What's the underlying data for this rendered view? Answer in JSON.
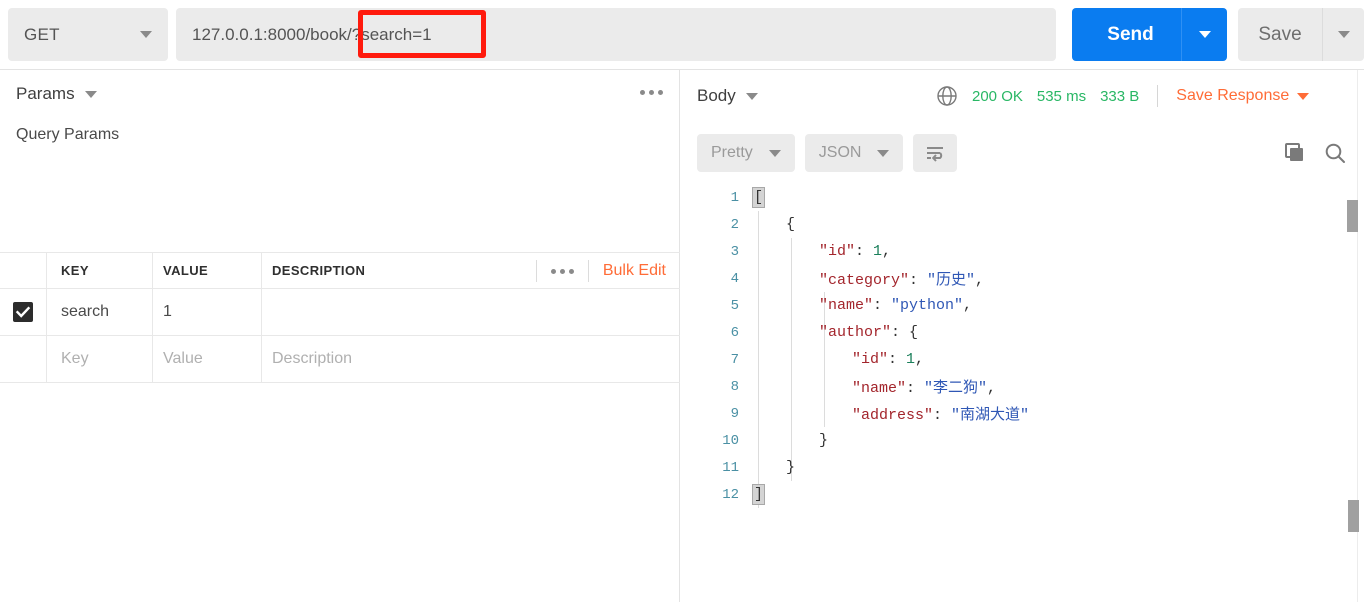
{
  "request_bar": {
    "method": "GET",
    "url": "127.0.0.1:8000/book/?search=1",
    "send_label": "Send",
    "save_label": "Save",
    "annotation_color": "#ff1a0d",
    "send_color": "#0a7cf0"
  },
  "params_panel": {
    "tab_label": "Params",
    "section_label": "Query Params",
    "columns": [
      "KEY",
      "VALUE",
      "DESCRIPTION"
    ],
    "bulk_edit_label": "Bulk Edit",
    "bulk_edit_color": "#ff6c37",
    "rows": [
      {
        "checked": true,
        "key": "search",
        "value": "1",
        "description": ""
      }
    ],
    "empty_row": {
      "key": "Key",
      "value": "Value",
      "description": "Description"
    }
  },
  "response_panel": {
    "body_label": "Body",
    "status": "200 OK",
    "time": "535 ms",
    "size": "333 B",
    "status_color": "#29b765",
    "save_response_label": "Save Response",
    "format_label": "Pretty",
    "language_label": "JSON",
    "body_lines": [
      {
        "num": "1",
        "indent": 0,
        "tokens": [
          {
            "t": "[",
            "c": "bracket"
          }
        ]
      },
      {
        "num": "2",
        "indent": 1,
        "tokens": [
          {
            "t": "{",
            "c": "p"
          }
        ]
      },
      {
        "num": "3",
        "indent": 2,
        "tokens": [
          {
            "t": "\"id\"",
            "c": "k"
          },
          {
            "t": ": ",
            "c": "p"
          },
          {
            "t": "1",
            "c": "n"
          },
          {
            "t": ",",
            "c": "p"
          }
        ]
      },
      {
        "num": "4",
        "indent": 2,
        "tokens": [
          {
            "t": "\"category\"",
            "c": "k"
          },
          {
            "t": ": ",
            "c": "p"
          },
          {
            "t": "\"历史\"",
            "c": "s"
          },
          {
            "t": ",",
            "c": "p"
          }
        ]
      },
      {
        "num": "5",
        "indent": 2,
        "tokens": [
          {
            "t": "\"name\"",
            "c": "k"
          },
          {
            "t": ": ",
            "c": "p"
          },
          {
            "t": "\"python\"",
            "c": "s"
          },
          {
            "t": ",",
            "c": "p"
          }
        ]
      },
      {
        "num": "6",
        "indent": 2,
        "tokens": [
          {
            "t": "\"author\"",
            "c": "k"
          },
          {
            "t": ": ",
            "c": "p"
          },
          {
            "t": "{",
            "c": "p"
          }
        ]
      },
      {
        "num": "7",
        "indent": 3,
        "tokens": [
          {
            "t": "\"id\"",
            "c": "k"
          },
          {
            "t": ": ",
            "c": "p"
          },
          {
            "t": "1",
            "c": "n"
          },
          {
            "t": ",",
            "c": "p"
          }
        ]
      },
      {
        "num": "8",
        "indent": 3,
        "tokens": [
          {
            "t": "\"name\"",
            "c": "k"
          },
          {
            "t": ": ",
            "c": "p"
          },
          {
            "t": "\"李二狗\"",
            "c": "s"
          },
          {
            "t": ",",
            "c": "p"
          }
        ]
      },
      {
        "num": "9",
        "indent": 3,
        "tokens": [
          {
            "t": "\"address\"",
            "c": "k"
          },
          {
            "t": ": ",
            "c": "p"
          },
          {
            "t": "\"南湖大道\"",
            "c": "s"
          }
        ]
      },
      {
        "num": "10",
        "indent": 2,
        "tokens": [
          {
            "t": "}",
            "c": "p"
          }
        ]
      },
      {
        "num": "11",
        "indent": 1,
        "tokens": [
          {
            "t": "}",
            "c": "p"
          }
        ]
      },
      {
        "num": "12",
        "indent": 0,
        "tokens": [
          {
            "t": "]",
            "c": "bracket"
          }
        ]
      }
    ]
  }
}
